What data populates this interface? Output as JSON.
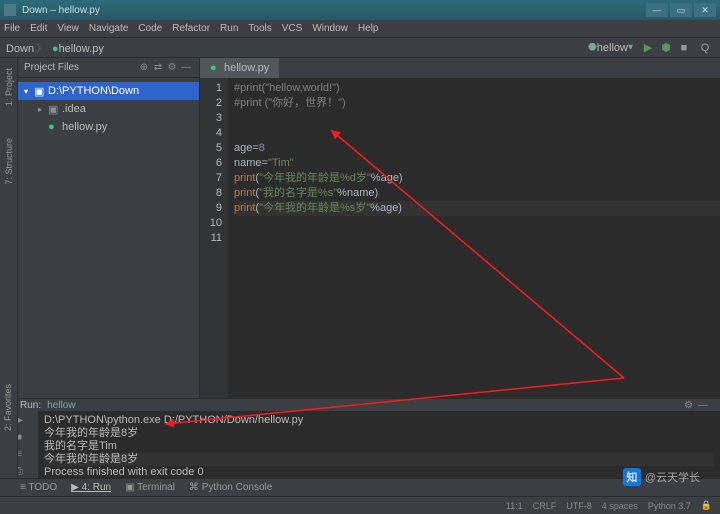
{
  "window": {
    "title": "Down – hellow.py"
  },
  "menu": [
    "File",
    "Edit",
    "View",
    "Navigate",
    "Code",
    "Refactor",
    "Run",
    "Tools",
    "VCS",
    "Window",
    "Help"
  ],
  "nav": {
    "crumb1": "Down",
    "crumb2": "hellow.py",
    "runconfig": "hellow"
  },
  "project": {
    "header": "Project Files",
    "root": "D:\\PYTHON\\Down",
    "folder": ".idea",
    "file": "hellow.py"
  },
  "editor": {
    "tab": "hellow.py",
    "gutter": [
      "1",
      "2",
      "3",
      "4",
      "5",
      "6",
      "7",
      "8",
      "9",
      "10",
      "11"
    ],
    "lines": {
      "l1a": "#print(",
      "l1b": "\"hellow,world!\"",
      "l1c": ")",
      "l2": "#print (\"你好，世界！\")",
      "l5": "age=",
      "l5n": "8",
      "l6": "name=",
      "l6s": "\"Tim\"",
      "l7a": "print",
      "l7b": "(",
      "l7c": "\"今年我的年龄是%d岁\"",
      "l7d": "%age)",
      "l8a": "print",
      "l8b": "(",
      "l8c": "\"我的名字是%s\"",
      "l8d": "%name)",
      "l9a": "print",
      "l9b": "(",
      "l9c": "\"今年我的年龄是%s岁\"",
      "l9d": "%age)"
    }
  },
  "run": {
    "label": "Run:",
    "name": "hellow",
    "out1": "D:\\PYTHON\\python.exe D:/PYTHON/Down/hellow.py",
    "out2": "今年我的年龄是8岁",
    "out3": "我的名字是Tim",
    "out4": "今年我的年龄是8岁",
    "out5": "",
    "out6": "Process finished with exit code 0"
  },
  "bottom": {
    "todo": "≡ TODO",
    "run": "▶ 4: Run",
    "term": "▣ Terminal",
    "pyc": "⌘ Python Console"
  },
  "status": {
    "pos": "11:1",
    "crlf": "CRLF",
    "enc": "UTF-8",
    "indent": "4 spaces",
    "py": "Python 3.7"
  },
  "sidebar": {
    "proj": "1: Project",
    "struct": "7: Structure",
    "fav": "2: Favorites"
  },
  "watermark": "@云天学长",
  "wm_logo": "知"
}
